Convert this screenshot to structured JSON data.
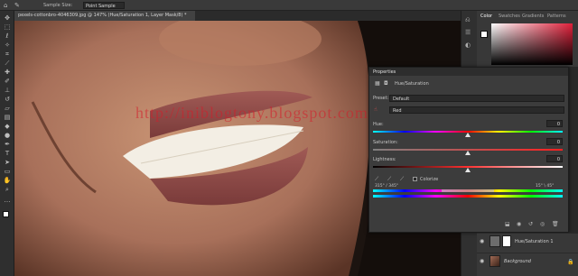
{
  "options_bar": {
    "sample_size_label": "Sample Size:",
    "sample_size_value": "Point Sample"
  },
  "document_tab": {
    "title": "pexels-cottonbro-4046309.jpg @ 147% (Hue/Saturation 1, Layer Mask/8) *"
  },
  "watermark": "http://iniblogtony.blogspot.com",
  "color_panel": {
    "tabs": [
      "Color",
      "Swatches",
      "Gradients",
      "Patterns"
    ]
  },
  "properties": {
    "title": "Properties",
    "subtitle": "Hue/Saturation",
    "preset_label": "Preset:",
    "preset_value": "Default",
    "channel_value": "Red",
    "hue_label": "Hue:",
    "hue_value": "0",
    "saturation_label": "Saturation:",
    "saturation_value": "0",
    "lightness_label": "Lightness:",
    "lightness_value": "0",
    "colorize_label": "Colorize",
    "range_left": "315° / 345°",
    "range_right": "15° \\ 45°"
  },
  "layers": [
    {
      "name": "Hue/Saturation 1"
    },
    {
      "name": "Background"
    }
  ],
  "colors": {
    "accent": "#d41c2a",
    "panel_bg": "#3c3c3c",
    "canvas_bg": "#1a1410"
  },
  "icons": [
    "move-icon",
    "marquee-icon",
    "lasso-icon",
    "quick-select-icon",
    "crop-icon",
    "eyedropper-icon",
    "healing-icon",
    "brush-icon",
    "stamp-icon",
    "history-brush-icon",
    "eraser-icon",
    "gradient-icon",
    "blur-icon",
    "dodge-icon",
    "pen-icon",
    "type-icon",
    "path-select-icon",
    "shape-icon",
    "hand-icon",
    "zoom-icon"
  ]
}
